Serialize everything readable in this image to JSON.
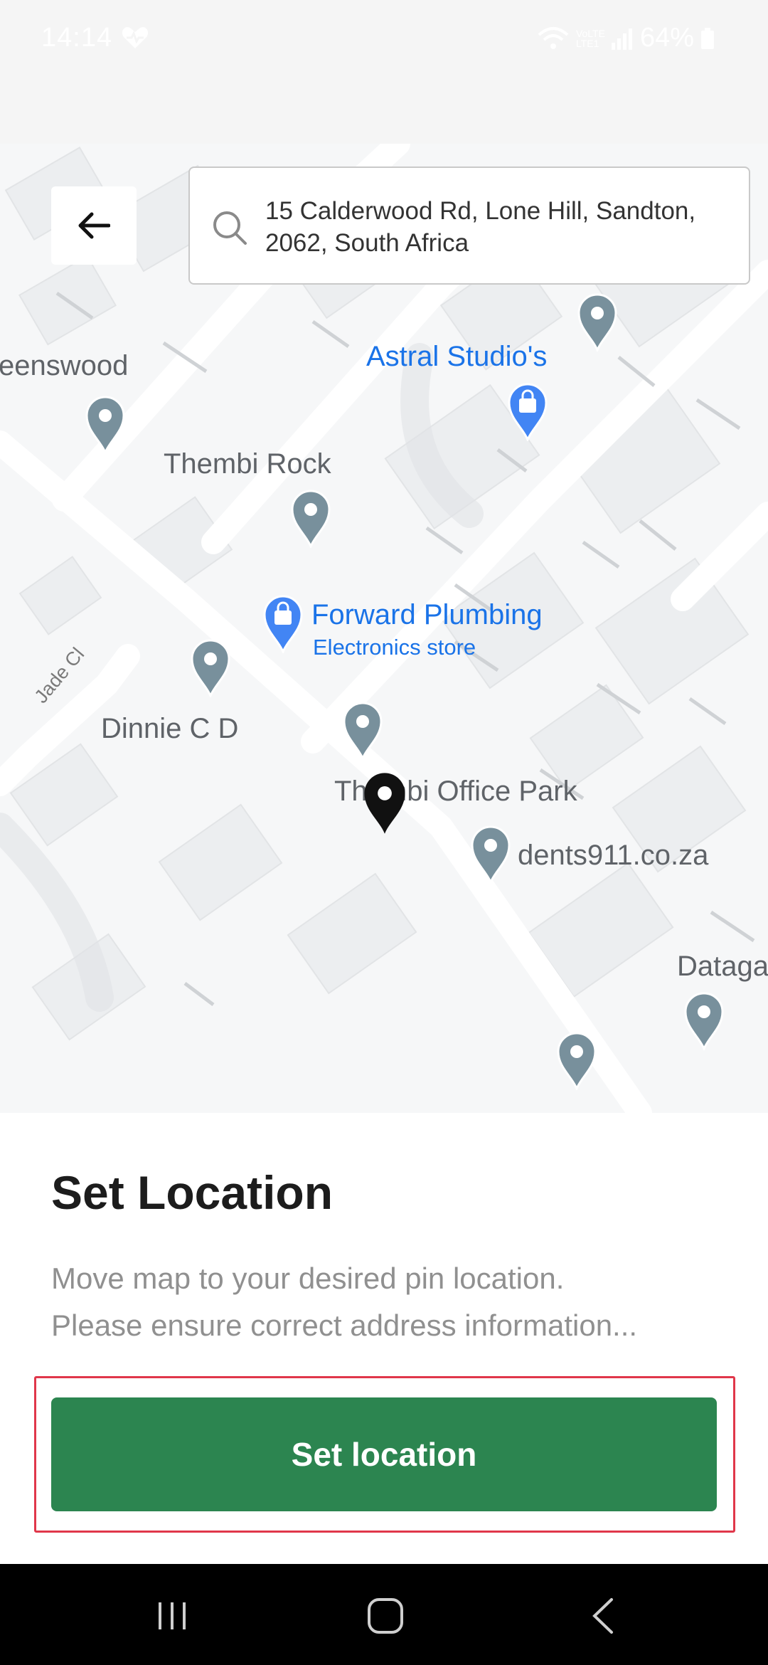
{
  "status_bar": {
    "time": "14:14",
    "battery": "64%",
    "network": "VoLTE LTE1"
  },
  "search": {
    "address_line1": "15 Calderwood Rd, Lone Hill, Sandton,",
    "address_line2": "2062, South Africa"
  },
  "map": {
    "labels": {
      "greenswood": "eenswood",
      "astral": "Astral Studio's",
      "thembi_rock": "Thembi Rock",
      "forward_plumbing": "Forward Plumbing",
      "electronics_store": "Electronics store",
      "dinnie": "Dinnie C D",
      "office_park": "Thembi Office Park",
      "dents": "dents911.co.za",
      "dataga": "Dataga",
      "jade_cl": "Jade Cl"
    }
  },
  "sheet": {
    "title": "Set Location",
    "desc_line1": "Move map to your desired pin location.",
    "desc_line2": "Please ensure correct address information...",
    "button_label": "Set location"
  },
  "colors": {
    "primary_button": "#2c8550",
    "highlight": "#e0374a",
    "poi_blue": "#1a73e8",
    "pin_grey": "#78909c"
  },
  "icons": [
    "back-arrow-icon",
    "search-icon",
    "location-pin-icon",
    "shopping-bag-icon",
    "recents-icon",
    "home-icon",
    "back-icon"
  ]
}
